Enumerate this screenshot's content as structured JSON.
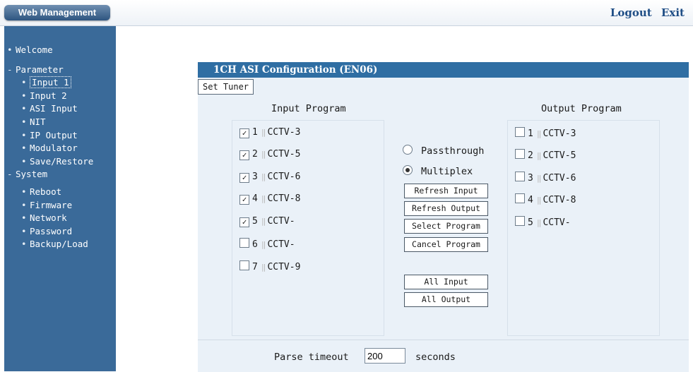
{
  "header": {
    "brand": "Web Management",
    "logout": "Logout",
    "exit": "Exit"
  },
  "sidebar": {
    "welcome": "Welcome",
    "parameter": {
      "label": "Parameter",
      "items": [
        "Input 1",
        "Input 2",
        "ASI Input",
        "NIT",
        "IP Output",
        "Modulator",
        "Save/Restore"
      ],
      "selected": "Input 1"
    },
    "system": {
      "label": "System",
      "items": [
        "Reboot",
        "Firmware",
        "Network",
        "Password",
        "Backup/Load"
      ]
    },
    "collapse_glyph": "-",
    "bullet_glyph": "•"
  },
  "panel": {
    "title": "1CH ASI Configuration (EN06)",
    "tab": "Set Tuner",
    "input_heading": "Input Program",
    "output_heading": "Output Program",
    "input_programs": [
      {
        "num": "1",
        "name": "CCTV-3",
        "checked": true
      },
      {
        "num": "2",
        "name": "CCTV-5",
        "checked": true
      },
      {
        "num": "3",
        "name": "CCTV-6",
        "checked": true
      },
      {
        "num": "4",
        "name": "CCTV-8",
        "checked": true
      },
      {
        "num": "5",
        "name": "CCTV-",
        "checked": true
      },
      {
        "num": "6",
        "name": "CCTV-",
        "checked": false
      },
      {
        "num": "7",
        "name": "CCTV-9",
        "checked": false
      }
    ],
    "output_programs": [
      {
        "num": "1",
        "name": "CCTV-3",
        "checked": false
      },
      {
        "num": "2",
        "name": "CCTV-5",
        "checked": false
      },
      {
        "num": "3",
        "name": "CCTV-6",
        "checked": false
      },
      {
        "num": "4",
        "name": "CCTV-8",
        "checked": false
      },
      {
        "num": "5",
        "name": "CCTV-",
        "checked": false
      }
    ],
    "mode": {
      "passthrough": "Passthrough",
      "multiplex": "Multiplex",
      "selected": "Multiplex"
    },
    "buttons": {
      "refresh_input": "Refresh Input",
      "refresh_output": "Refresh Output",
      "select_program": "Select Program",
      "cancel_program": "Cancel Program",
      "all_input": "All Input",
      "all_output": "All Output"
    },
    "timeout": {
      "label": "Parse timeout",
      "value": "200",
      "unit": "seconds"
    }
  },
  "colors": {
    "sidebar_bg": "#3a6a99",
    "title_bar": "#2f6ea3",
    "panel_bg": "#eaf1f8",
    "link": "#1f4e86"
  }
}
